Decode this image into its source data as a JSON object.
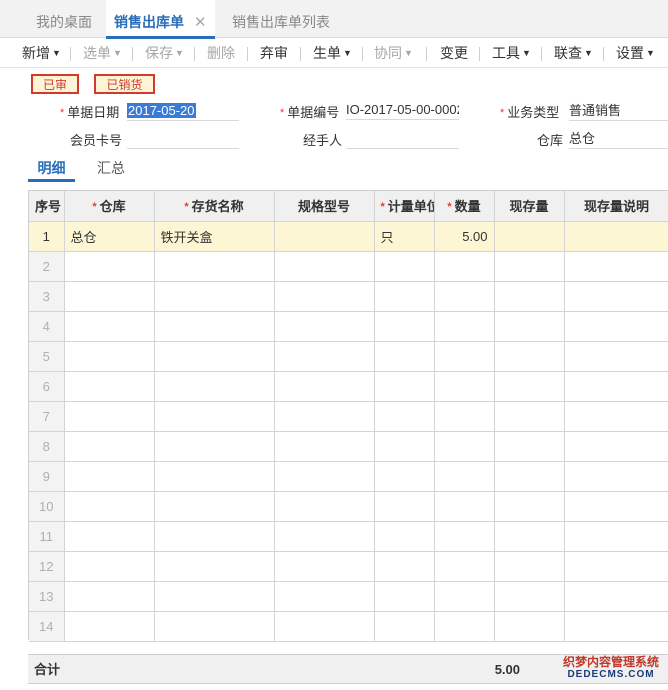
{
  "tabs": [
    {
      "label": "我的桌面"
    },
    {
      "label": "销售出库单",
      "close": "✕"
    },
    {
      "label": "销售出库单列表"
    }
  ],
  "toolbar": {
    "add": "新增",
    "select": "选单",
    "save": "保存",
    "delete": "删除",
    "abandon": "弃审",
    "generate": "生单",
    "collaborate": "协同",
    "change": "变更",
    "tools": "工具",
    "link": "联查",
    "settings": "设置"
  },
  "badges": {
    "audited": "已审",
    "sold": "已销货"
  },
  "form": {
    "date_label": "单据日期",
    "date_value": "2017-05-20",
    "code_label": "单据编号",
    "code_value": "IO-2017-05-00-0002",
    "biztype_label": "业务类型",
    "biztype_value": "普通销售",
    "member_label": "会员卡号",
    "member_value": "",
    "handler_label": "经手人",
    "handler_value": "",
    "warehouse_label": "仓库",
    "warehouse_value": "总仓"
  },
  "subtabs": {
    "detail": "明细",
    "summary": "汇总"
  },
  "grid": {
    "headers": {
      "seq": "序号",
      "warehouse": "仓库",
      "name": "存货名称",
      "spec": "规格型号",
      "unit": "计量单位",
      "qty": "数量",
      "stock": "现存量",
      "stock_note": "现存量说明"
    },
    "rows": [
      {
        "seq": "1",
        "warehouse": "总仓",
        "name": "铁开关盒",
        "spec": "",
        "unit": "只",
        "qty": "5.00",
        "stock": "",
        "stock_note": ""
      },
      {
        "seq": "2",
        "warehouse": "",
        "name": "",
        "spec": "",
        "unit": "",
        "qty": "",
        "stock": "",
        "stock_note": ""
      },
      {
        "seq": "3",
        "warehouse": "",
        "name": "",
        "spec": "",
        "unit": "",
        "qty": "",
        "stock": "",
        "stock_note": ""
      },
      {
        "seq": "4",
        "warehouse": "",
        "name": "",
        "spec": "",
        "unit": "",
        "qty": "",
        "stock": "",
        "stock_note": ""
      },
      {
        "seq": "5",
        "warehouse": "",
        "name": "",
        "spec": "",
        "unit": "",
        "qty": "",
        "stock": "",
        "stock_note": ""
      },
      {
        "seq": "6",
        "warehouse": "",
        "name": "",
        "spec": "",
        "unit": "",
        "qty": "",
        "stock": "",
        "stock_note": ""
      },
      {
        "seq": "7",
        "warehouse": "",
        "name": "",
        "spec": "",
        "unit": "",
        "qty": "",
        "stock": "",
        "stock_note": ""
      },
      {
        "seq": "8",
        "warehouse": "",
        "name": "",
        "spec": "",
        "unit": "",
        "qty": "",
        "stock": "",
        "stock_note": ""
      },
      {
        "seq": "9",
        "warehouse": "",
        "name": "",
        "spec": "",
        "unit": "",
        "qty": "",
        "stock": "",
        "stock_note": ""
      },
      {
        "seq": "10",
        "warehouse": "",
        "name": "",
        "spec": "",
        "unit": "",
        "qty": "",
        "stock": "",
        "stock_note": ""
      },
      {
        "seq": "11",
        "warehouse": "",
        "name": "",
        "spec": "",
        "unit": "",
        "qty": "",
        "stock": "",
        "stock_note": ""
      },
      {
        "seq": "12",
        "warehouse": "",
        "name": "",
        "spec": "",
        "unit": "",
        "qty": "",
        "stock": "",
        "stock_note": ""
      },
      {
        "seq": "13",
        "warehouse": "",
        "name": "",
        "spec": "",
        "unit": "",
        "qty": "",
        "stock": "",
        "stock_note": ""
      },
      {
        "seq": "14",
        "warehouse": "",
        "name": "",
        "spec": "",
        "unit": "",
        "qty": "",
        "stock": "",
        "stock_note": ""
      }
    ],
    "total_label": "合计",
    "total_qty": "5.00"
  },
  "watermark": {
    "line1": "织梦内容管理系统",
    "line2": "DEDECMS.COM"
  },
  "colors": {
    "accent": "#2a6ebb",
    "badge": "#d23b2a",
    "badge_bg": "#fdf4d8",
    "row_highlight": "#fdf6d5"
  }
}
